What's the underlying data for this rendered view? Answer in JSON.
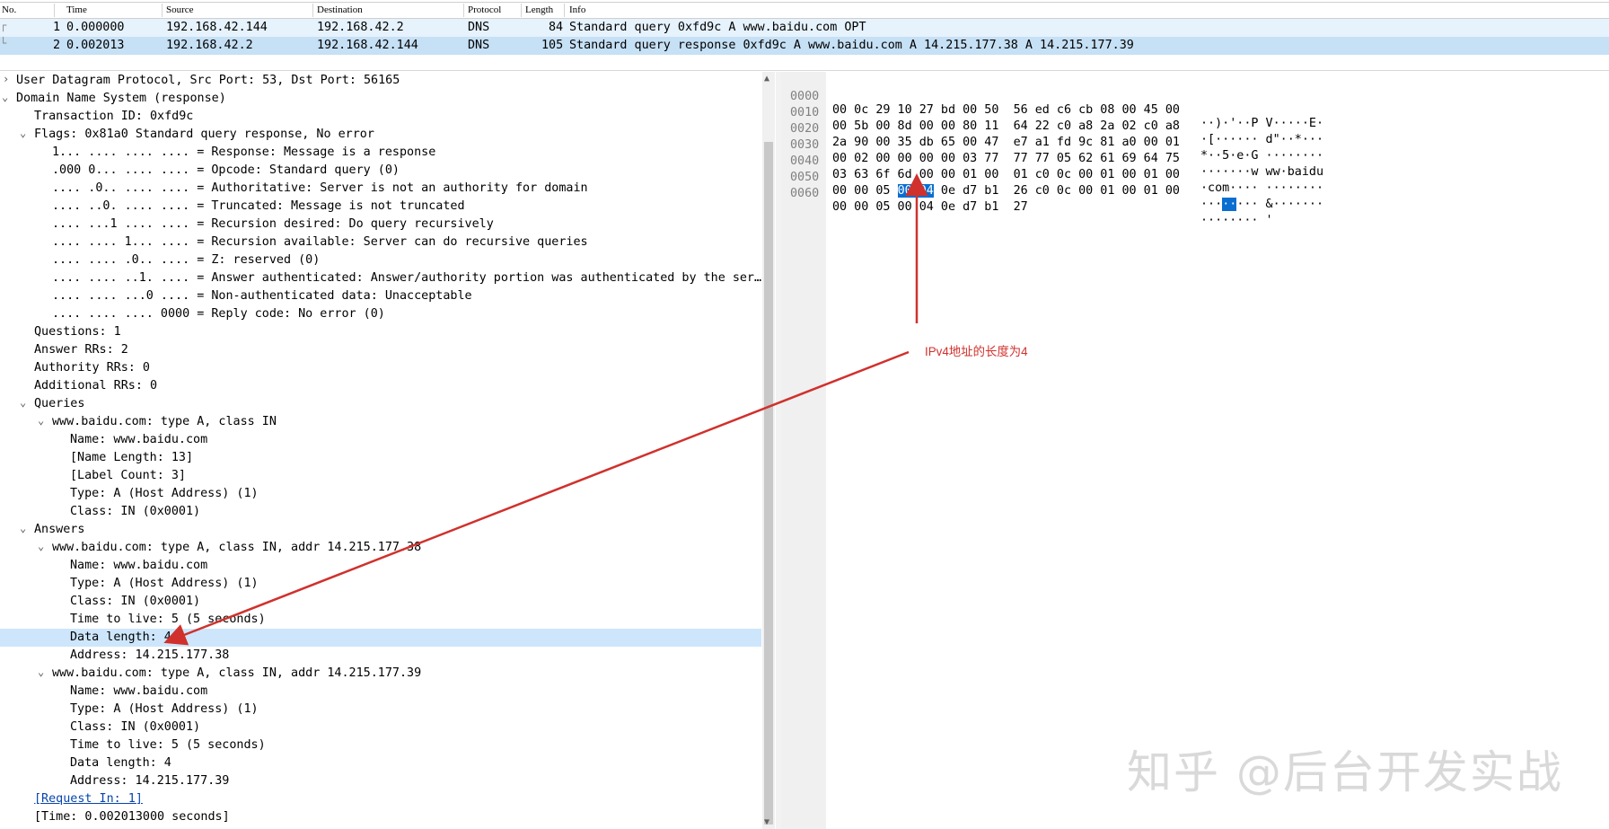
{
  "packet_list": {
    "columns": [
      "No.",
      "Time",
      "Source",
      "Destination",
      "Protocol",
      "Length",
      "Info"
    ],
    "rows": [
      {
        "no": "1",
        "time": "0.000000",
        "source": "192.168.42.144",
        "destination": "192.168.42.2",
        "protocol": "DNS",
        "length": "84",
        "info": "Standard query 0xfd9c A www.baidu.com OPT"
      },
      {
        "no": "2",
        "time": "0.002013",
        "source": "192.168.42.2",
        "destination": "192.168.42.144",
        "protocol": "DNS",
        "length": "105",
        "info": "Standard query response 0xfd9c A www.baidu.com A 14.215.177.38 A 14.215.177.39"
      }
    ]
  },
  "details": {
    "lines": [
      "User Datagram Protocol, Src Port: 53, Dst Port: 56165",
      "Domain Name System (response)",
      "Transaction ID: 0xfd9c",
      "Flags: 0x81a0 Standard query response, No error",
      "1... .... .... .... = Response: Message is a response",
      ".000 0... .... .... = Opcode: Standard query (0)",
      ".... .0.. .... .... = Authoritative: Server is not an authority for domain",
      ".... ..0. .... .... = Truncated: Message is not truncated",
      ".... ...1 .... .... = Recursion desired: Do query recursively",
      ".... .... 1... .... = Recursion available: Server can do recursive queries",
      ".... .... .0.. .... = Z: reserved (0)",
      ".... .... ..1. .... = Answer authenticated: Answer/authority portion was authenticated by the ser…",
      ".... .... ...0 .... = Non-authenticated data: Unacceptable",
      ".... .... .... 0000 = Reply code: No error (0)",
      "Questions: 1",
      "Answer RRs: 2",
      "Authority RRs: 0",
      "Additional RRs: 0",
      "Queries",
      "www.baidu.com: type A, class IN",
      "Name: www.baidu.com",
      "[Name Length: 13]",
      "[Label Count: 3]",
      "Type: A (Host Address) (1)",
      "Class: IN (0x0001)",
      "Answers",
      "www.baidu.com: type A, class IN, addr 14.215.177.38",
      "Name: www.baidu.com",
      "Type: A (Host Address) (1)",
      "Class: IN (0x0001)",
      "Time to live: 5 (5 seconds)",
      "Data length: 4",
      "Address: 14.215.177.38",
      "www.baidu.com: type A, class IN, addr 14.215.177.39",
      "Name: www.baidu.com",
      "Type: A (Host Address) (1)",
      "Class: IN (0x0001)",
      "Time to live: 5 (5 seconds)",
      "Data length: 4",
      "Address: 14.215.177.39",
      "[Request In: 1]",
      "[Time: 0.002013000 seconds]"
    ]
  },
  "hex": {
    "rows": [
      {
        "offset": "0000",
        "b1": "00 0c 29 10 27 bd 00 50",
        "b2": "56 ed c6 cb 08 00 45 00",
        "ascii": "··)·'··P V·····E·"
      },
      {
        "offset": "0010",
        "b1": "00 5b 00 8d 00 00 80 11",
        "b2": "64 22 c0 a8 2a 02 c0 a8",
        "ascii": "·[······ d\"··*···"
      },
      {
        "offset": "0020",
        "b1": "2a 90 00 35 db 65 00 47",
        "b2": "e7 a1 fd 9c 81 a0 00 01",
        "ascii": "*··5·e·G ········"
      },
      {
        "offset": "0030",
        "b1": "00 02 00 00 00 00 03 77",
        "b2": "77 77 05 62 61 69 64 75",
        "ascii": "·······w ww·baidu"
      },
      {
        "offset": "0040",
        "b1": "03 63 6f 6d 00 00 01 00",
        "b2": "01 c0 0c 00 01 00 01 00",
        "ascii": "·com···· ········"
      },
      {
        "offset": "0050",
        "b1_pre": "00 00 05 ",
        "b1_hl": "00 04",
        "b1_post": " 0e d7 b1",
        "b2": "26 c0 0c 00 01 00 01 00",
        "ascii_pre": "···",
        "ascii_hl": "··",
        "ascii_post": "··· &·······"
      },
      {
        "offset": "0060",
        "b1": "00 00 05 00 04 0e d7 b1",
        "b2": "27",
        "ascii": "········ '"
      }
    ]
  },
  "annotation": {
    "text": "IPv4地址的长度为4",
    "color": "#d0312d"
  },
  "watermark": {
    "text": "知乎 @后台开发实战"
  }
}
